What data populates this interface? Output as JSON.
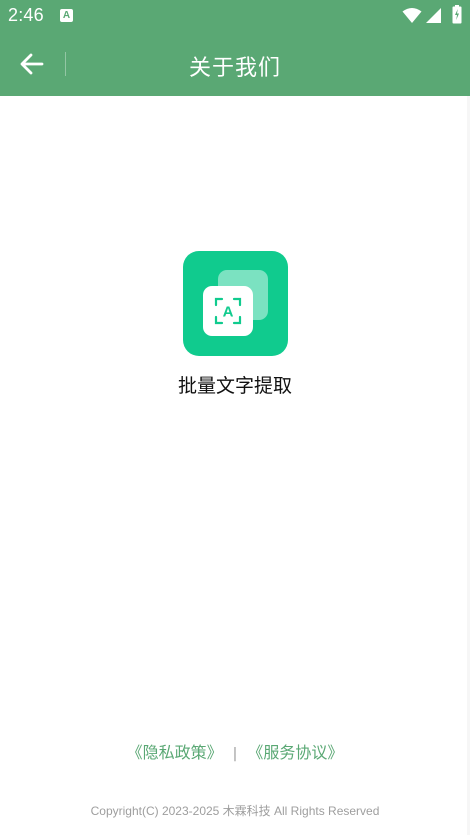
{
  "status_bar": {
    "time": "2:46",
    "notification_glyph": "A",
    "icons": [
      "wifi-icon",
      "signal-icon",
      "battery-icon"
    ]
  },
  "app_bar": {
    "title": "关于我们",
    "back_icon": "arrow-left-icon",
    "color": "#5aa874"
  },
  "app_info": {
    "logo_glyph": "A",
    "logo_color": "#10cb8e",
    "name": "批量文字提取"
  },
  "footer": {
    "privacy_link": "《隐私政策》",
    "separator": "|",
    "service_link": "《服务协议》",
    "copyright": "Copyright(C) 2023-2025 木霖科技 All Rights Reserved",
    "link_color": "#5aa874"
  }
}
